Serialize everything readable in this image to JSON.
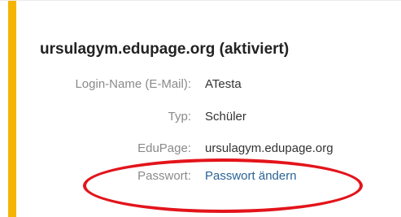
{
  "colors": {
    "accent": "#f5b400",
    "highlight": "#e3141b",
    "link": "#2a6496"
  },
  "account": {
    "title": "ursulagym.edupage.org (aktiviert)",
    "rows": [
      {
        "label": "Login-Name (E-Mail):",
        "value": "ATesta"
      },
      {
        "label": "Typ:",
        "value": "Schüler"
      },
      {
        "label": "EduPage:",
        "value": "ursulagym.edupage.org"
      },
      {
        "label": "Passwort:",
        "value": "Passwort ändern"
      }
    ]
  }
}
